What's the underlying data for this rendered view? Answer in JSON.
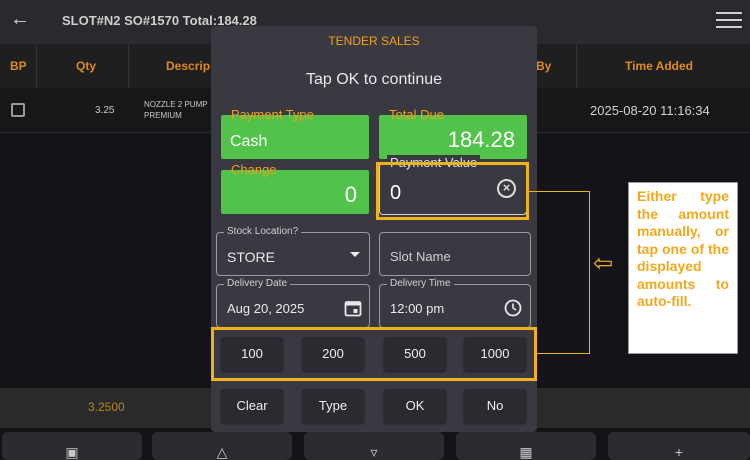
{
  "header": {
    "title": "SLOT#N2 SO#1570 Total:184.28"
  },
  "table": {
    "columns": [
      "BP",
      "Qty",
      "Descrip",
      "By",
      "Time Added"
    ],
    "rows": [
      {
        "qty": "3.25",
        "description": "NOZZLE 2 PUMP PREMIUM",
        "time_added": "2025-08-20 11:16:34"
      }
    ]
  },
  "footer": {
    "value": "3.2500"
  },
  "dialog": {
    "title": "TENDER SALES",
    "subtitle": "Tap OK to continue",
    "payment_type": {
      "label": "Payment Type",
      "value": "Cash"
    },
    "total_due": {
      "label": "Total Due",
      "value": "184.28"
    },
    "change": {
      "label": "Change",
      "value": "0"
    },
    "payment_value": {
      "label": "Payment Value",
      "value": "0"
    },
    "stock_location": {
      "label": "Stock Location?",
      "value": "STORE"
    },
    "slot_name": {
      "placeholder": "Slot Name"
    },
    "delivery_date": {
      "label": "Delivery Date",
      "value": "Aug 20, 2025"
    },
    "delivery_time": {
      "label": "Delivery Time",
      "value": "12:00 pm"
    },
    "quick_amounts": [
      "100",
      "200",
      "500",
      "1000"
    ],
    "actions": {
      "clear": "Clear",
      "type": "Type",
      "ok": "OK",
      "no": "No"
    }
  },
  "callout": {
    "text": "Either type the amount manually, or tap one of the displayed amounts to auto-fill."
  },
  "colors": {
    "accent_orange": "#f0a020",
    "highlight_yellow": "#f2b21d",
    "field_green": "#51c24a",
    "dialog_bg": "#3a3942"
  },
  "icons": [
    "back-arrow-icon",
    "hamburger-menu-icon",
    "dropdown-caret-icon",
    "calendar-icon",
    "clock-icon",
    "clear-circle-icon",
    "left-arrow-icon",
    "trash-icon",
    "flask-icon",
    "filter-icon",
    "calculator-icon",
    "plus-icon"
  ]
}
